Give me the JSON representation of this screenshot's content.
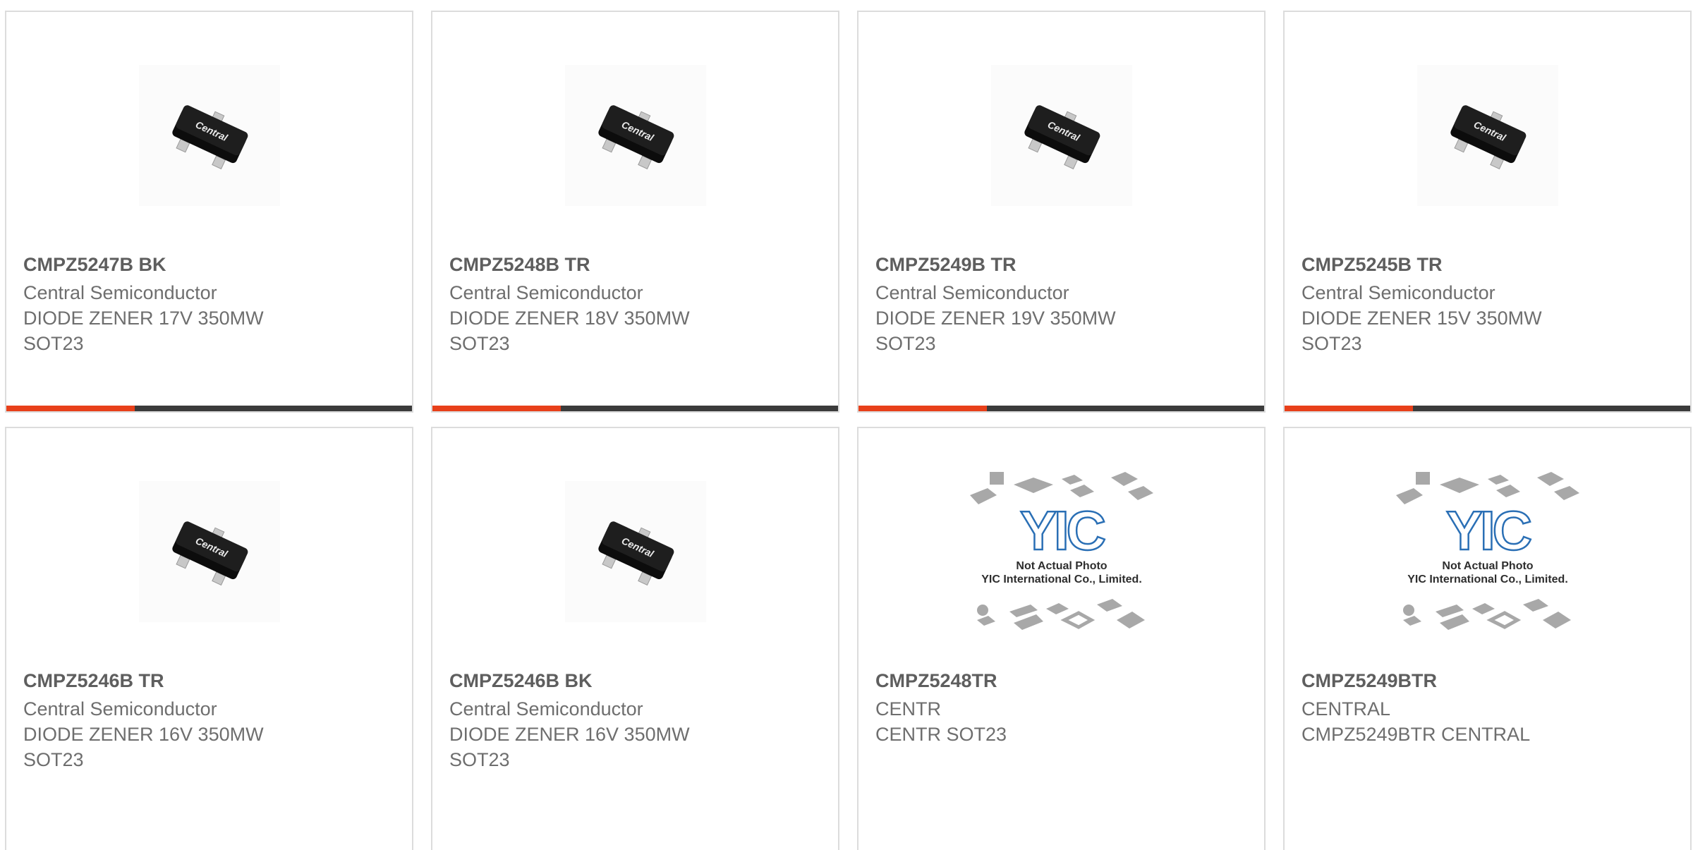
{
  "products": [
    {
      "part_number": "CMPZ5247B BK",
      "manufacturer": "Central Semiconductor",
      "description": "DIODE ZENER 17V 350MW",
      "package": "SOT23",
      "image": "central-sot23-photo",
      "accent": true
    },
    {
      "part_number": "CMPZ5248B TR",
      "manufacturer": "Central Semiconductor",
      "description": "DIODE ZENER 18V 350MW",
      "package": "SOT23",
      "image": "central-sot23-photo",
      "accent": true
    },
    {
      "part_number": "CMPZ5249B TR",
      "manufacturer": "Central Semiconductor",
      "description": "DIODE ZENER 19V 350MW",
      "package": "SOT23",
      "image": "central-sot23-photo",
      "accent": true
    },
    {
      "part_number": "CMPZ5245B TR",
      "manufacturer": "Central Semiconductor",
      "description": "DIODE ZENER 15V 350MW",
      "package": "SOT23",
      "image": "central-sot23-photo",
      "accent": true
    },
    {
      "part_number": "CMPZ5246B TR",
      "manufacturer": "Central Semiconductor",
      "description": "DIODE ZENER 16V 350MW",
      "package": "SOT23",
      "image": "central-sot23-photo",
      "accent": false
    },
    {
      "part_number": "CMPZ5246B BK",
      "manufacturer": "Central Semiconductor",
      "description": "DIODE ZENER 16V 350MW",
      "package": "SOT23",
      "image": "central-sot23-photo",
      "accent": false
    },
    {
      "part_number": "CMPZ5248TR",
      "manufacturer": "CENTR",
      "description": "CENTR SOT23",
      "package": "",
      "image": "yic-placeholder",
      "accent": false
    },
    {
      "part_number": "CMPZ5249BTR",
      "manufacturer": "CENTRAL",
      "description": "CMPZ5249BTR CENTRAL",
      "package": "",
      "image": "yic-placeholder",
      "accent": false
    }
  ],
  "placeholder": {
    "logo_text": "YIC",
    "caption_line1": "Not Actual Photo",
    "caption_line2": "YIC International Co., Limited."
  },
  "chip_label": "Central",
  "colors": {
    "accent": "#e8401a",
    "bar": "#3b3b3b",
    "border": "#dcdcdc",
    "text": "#6e6e6e",
    "yic_blue": "#2a6fb5"
  }
}
